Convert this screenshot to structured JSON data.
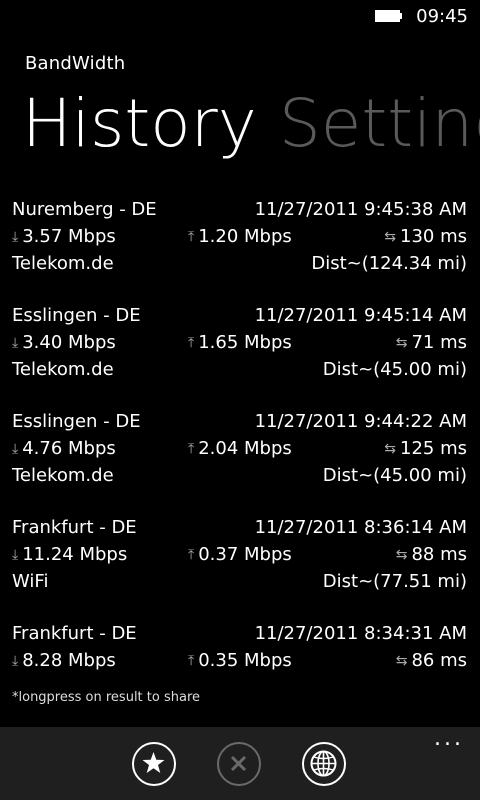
{
  "status": {
    "time": "09:45"
  },
  "app": {
    "title": "BandWidth"
  },
  "pivot": {
    "tabs": [
      "History",
      "Setting"
    ]
  },
  "results": [
    {
      "city": "Nuremberg - DE",
      "datetime": "11/27/2011 9:45:38 AM",
      "download": "3.57 Mbps",
      "upload": "1.20 Mbps",
      "ping": "130 ms",
      "isp": "Telekom.de",
      "distance": "Dist~(124.34 mi)"
    },
    {
      "city": "Esslingen - DE",
      "datetime": "11/27/2011 9:45:14 AM",
      "download": "3.40 Mbps",
      "upload": "1.65 Mbps",
      "ping": "71 ms",
      "isp": "Telekom.de",
      "distance": "Dist~(45.00 mi)"
    },
    {
      "city": "Esslingen - DE",
      "datetime": "11/27/2011 9:44:22 AM",
      "download": "4.76 Mbps",
      "upload": "2.04 Mbps",
      "ping": "125 ms",
      "isp": "Telekom.de",
      "distance": "Dist~(45.00 mi)"
    },
    {
      "city": "Frankfurt - DE",
      "datetime": "11/27/2011 8:36:14 AM",
      "download": "11.24 Mbps",
      "upload": "0.37 Mbps",
      "ping": "88 ms",
      "isp": "WiFi",
      "distance": "Dist~(77.51 mi)"
    },
    {
      "city": "Frankfurt - DE",
      "datetime": "11/27/2011 8:34:31 AM",
      "download": "8.28 Mbps",
      "upload": "0.35 Mbps",
      "ping": "86 ms",
      "isp": "",
      "distance": ""
    }
  ],
  "footnote": "*longpress on result to share",
  "appbar": {
    "buttons": [
      {
        "icon": "star-icon",
        "enabled": true
      },
      {
        "icon": "close-icon",
        "enabled": false
      },
      {
        "icon": "globe-icon",
        "enabled": true
      }
    ],
    "more": "..."
  }
}
